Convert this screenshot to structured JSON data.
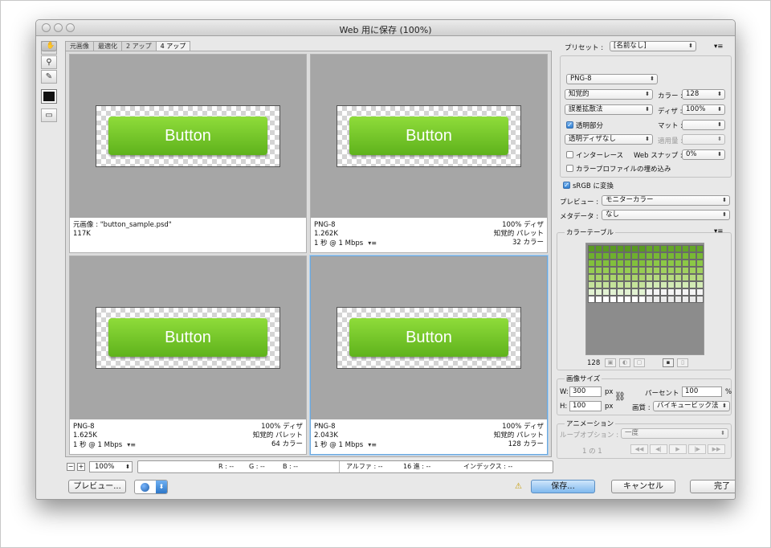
{
  "window": {
    "title": "Web 用に保存 (100%)"
  },
  "tabs": [
    {
      "label": "元画像",
      "active": false
    },
    {
      "label": "最適化",
      "active": false
    },
    {
      "label": "2 アップ",
      "active": false
    },
    {
      "label": "4 アップ",
      "active": true
    }
  ],
  "sample_button_text": "Button",
  "panes": [
    {
      "l1": "元画像 : \"button_sample.psd\"",
      "l2": "117K",
      "l3": "",
      "r1": "",
      "r2": "",
      "r3": "",
      "selected": false
    },
    {
      "l1": "PNG-8",
      "l2": "1.262K",
      "l3": "1 秒 @ 1 Mbps",
      "r1": "100% ディザ",
      "r2": "知覚的 パレット",
      "r3": "32 カラー",
      "selected": false
    },
    {
      "l1": "PNG-8",
      "l2": "1.625K",
      "l3": "1 秒 @ 1 Mbps",
      "r1": "100% ディザ",
      "r2": "知覚的 パレット",
      "r3": "64 カラー",
      "selected": false
    },
    {
      "l1": "PNG-8",
      "l2": "2.043K",
      "l3": "1 秒 @ 1 Mbps",
      "r1": "100% ディザ",
      "r2": "知覚的 パレット",
      "r3": "128 カラー",
      "selected": true
    }
  ],
  "status": {
    "zoom": "100%",
    "r": "R : --",
    "g": "G : --",
    "b": "B : --",
    "alpha": "アルファ : --",
    "hex": "16 進 : --",
    "index": "インデックス : --"
  },
  "buttons": {
    "preview": "プレビュー...",
    "save": "保存...",
    "cancel": "キャンセル",
    "done": "完了"
  },
  "settings": {
    "preset_label": "プリセット :",
    "preset_value": "[名前なし]",
    "format": "PNG-8",
    "reduction": "知覚的",
    "colors_label": "カラー :",
    "colors_value": "128",
    "dither_algo": "誤差拡散法",
    "dither_label": "ディザ :",
    "dither_value": "100%",
    "transparency_label": "透明部分",
    "transparency_checked": true,
    "matte_label": "マット :",
    "matte_value": "",
    "trans_dither": "透明ディザなし",
    "amount_label": "適用量 :",
    "amount_value": "",
    "interlace_label": "インターレース",
    "interlace_checked": false,
    "websnap_label": "Web スナップ :",
    "websnap_value": "0%",
    "embed_profile_label": "カラープロファイルの埋め込み",
    "embed_profile_checked": false,
    "srgb_label": "sRGB に変換",
    "srgb_checked": true,
    "preview_label": "プレビュー :",
    "preview_value": "モニターカラー",
    "metadata_label": "メタデータ :",
    "metadata_value": "なし"
  },
  "color_table": {
    "title": "カラーテーブル",
    "count": "128",
    "swatches": [
      "#5a9a22",
      "#64a628",
      "#6eb02e",
      "#78b834",
      "#82c03c",
      "#8cc846",
      "#96cc52",
      "#a0d05e",
      "#aad46c",
      "#b6da80",
      "#c4e29a",
      "#d2eab4",
      "#e2f2d2",
      "#f4f4f4",
      "#ffffff",
      "#eaeaea"
    ]
  },
  "image_size": {
    "title": "画像サイズ",
    "w_label": "W:",
    "w_value": "300",
    "w_unit": "px",
    "h_label": "H:",
    "h_value": "100",
    "h_unit": "px",
    "percent_label": "パーセント :",
    "percent_value": "100",
    "percent_unit": "%",
    "quality_label": "画質 :",
    "quality_value": "バイキュービック法"
  },
  "animation": {
    "title": "アニメーション",
    "loop_label": "ループオプション :",
    "loop_value": "一度",
    "frame": "1 の 1"
  }
}
